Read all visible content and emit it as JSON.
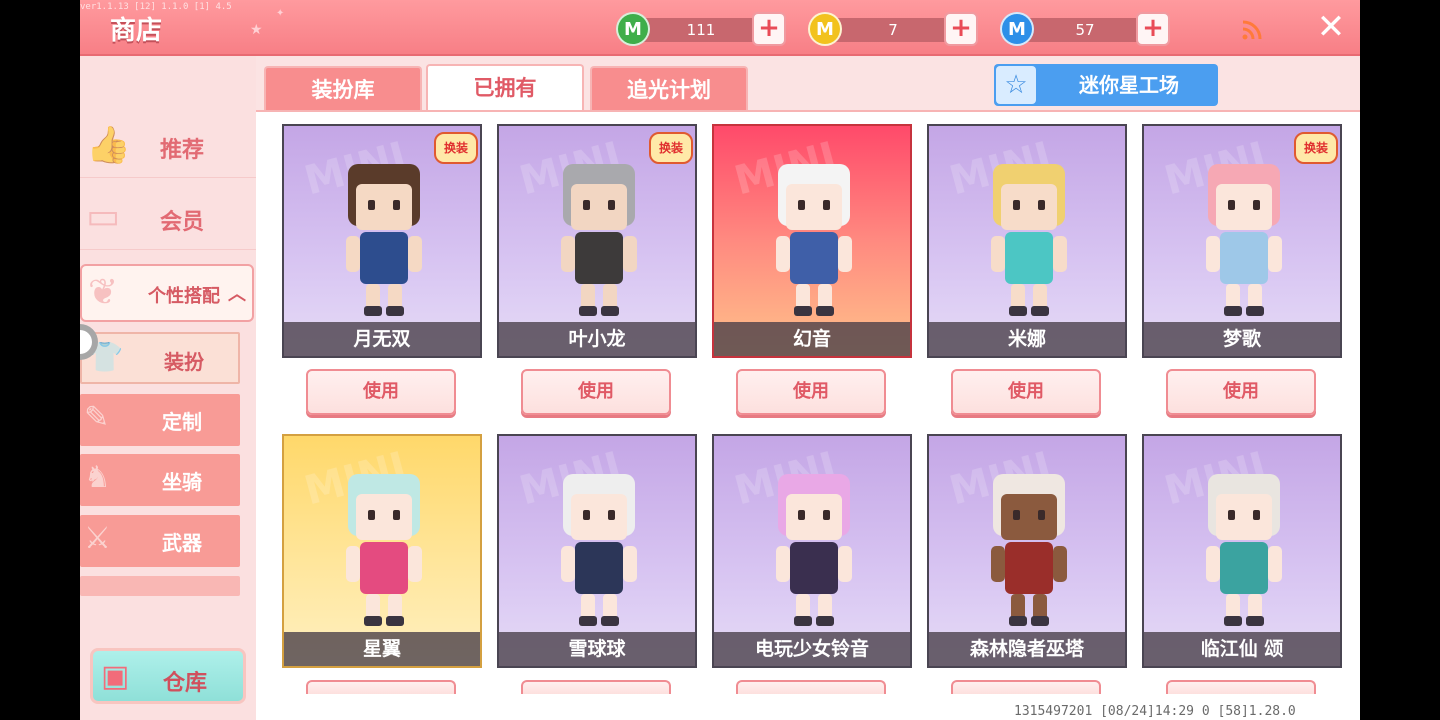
{
  "header": {
    "title": "商店",
    "debug_text": "ver1.1.13 [12] 1.1.0 [1] 4.5"
  },
  "currencies": [
    {
      "name": "mini-bean",
      "glyph": "M",
      "color": "#3fae4a",
      "value": "111"
    },
    {
      "name": "mini-coin",
      "glyph": "M",
      "color": "#f2c21d",
      "value": "7"
    },
    {
      "name": "star-coin",
      "glyph": "M",
      "color": "#2d8fe8",
      "value": "57"
    }
  ],
  "sidebar": {
    "recommend": "推荐",
    "vip": "会员",
    "personal": "个性搭配",
    "subs": [
      "装扮",
      "定制",
      "坐骑",
      "武器"
    ],
    "warehouse": "仓库"
  },
  "tabs": [
    "装扮库",
    "已拥有",
    "追光计划"
  ],
  "workshop_label": "迷你星工场",
  "badge_text": "换装",
  "use_label": "使用",
  "cards": [
    {
      "name": "月无双",
      "badge": true,
      "style": "normal",
      "hair": "#5a3b2a",
      "outfit": "#2d4d8e",
      "skin": "#f5d9c4"
    },
    {
      "name": "叶小龙",
      "badge": true,
      "style": "normal",
      "hair": "#a9a9ad",
      "outfit": "#3d3a3a",
      "skin": "#f2d6c2"
    },
    {
      "name": "幻音",
      "badge": false,
      "style": "hl",
      "hair": "#f4f4f4",
      "outfit": "#3f5fa8",
      "skin": "#fbe6db"
    },
    {
      "name": "米娜",
      "badge": false,
      "style": "normal",
      "hair": "#f0d070",
      "outfit": "#4cc6c4",
      "skin": "#f7dcc9"
    },
    {
      "name": "梦歌",
      "badge": true,
      "style": "normal",
      "hair": "#f6a8b4",
      "outfit": "#9ec8e8",
      "skin": "#fbe6db"
    },
    {
      "name": "星翼",
      "badge": false,
      "style": "gold",
      "hair": "#bfe8e4",
      "outfit": "#e44b80",
      "skin": "#fbe6db"
    },
    {
      "name": "雪球球",
      "badge": false,
      "style": "normal",
      "hair": "#eeeeee",
      "outfit": "#2c3658",
      "skin": "#fbe6db"
    },
    {
      "name": "电玩少女铃音",
      "badge": false,
      "style": "normal",
      "hair": "#e9a8e6",
      "outfit": "#3a2f4f",
      "skin": "#fbe6db"
    },
    {
      "name": "森林隐者巫塔",
      "badge": false,
      "style": "normal",
      "hair": "#efe7e1",
      "outfit": "#9a2e2a",
      "skin": "#8b5a3e"
    },
    {
      "name": "临江仙 颂",
      "badge": false,
      "style": "normal",
      "hair": "#e9e5e0",
      "outfit": "#3ba3a0",
      "skin": "#fbe6db"
    }
  ],
  "footer": "1315497201   [08/24]14:29 0  [58]1.28.0"
}
